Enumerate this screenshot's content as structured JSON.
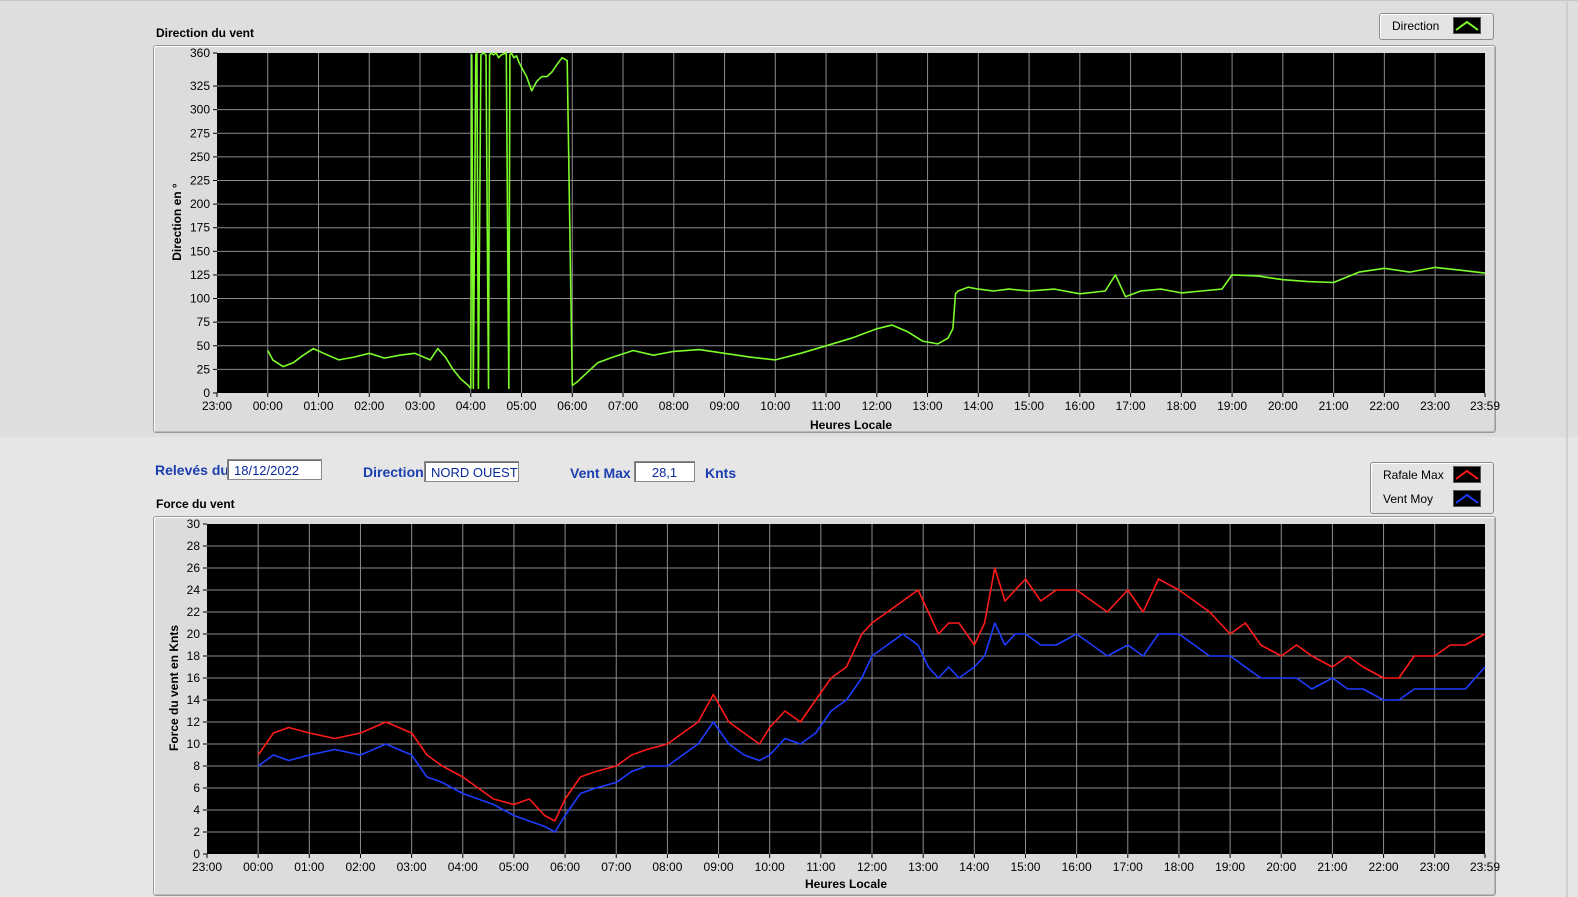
{
  "info": {
    "releves_label": "Relevés du",
    "releves_value": "18/12/2022",
    "direction_label": "Direction",
    "direction_value": "NORD OUEST",
    "ventmax_label": "Vent Max",
    "ventmax_value": "28,1",
    "ventmax_unit": "Knts"
  },
  "colors": {
    "direction": "#7cfc2a",
    "rafale": "#ff1a1a",
    "vent_moy": "#1e3cff",
    "plot_bg": "#000000",
    "grid": "#8c8c8c",
    "label_blue": "#1b3fb0"
  },
  "chart_data": [
    {
      "type": "line",
      "title": "Direction du vent",
      "xlabel": "Heures Locale",
      "ylabel": "Direction en °",
      "ylim": [
        0,
        360
      ],
      "xlim_hours": [
        -1,
        23.983
      ],
      "x_ticks": [
        "23:00",
        "00:00",
        "01:00",
        "02:00",
        "03:00",
        "04:00",
        "05:00",
        "06:00",
        "07:00",
        "08:00",
        "09:00",
        "10:00",
        "11:00",
        "12:00",
        "13:00",
        "14:00",
        "15:00",
        "16:00",
        "17:00",
        "18:00",
        "19:00",
        "20:00",
        "21:00",
        "22:00",
        "23:00",
        "23:59"
      ],
      "y_ticks": [
        0,
        25,
        50,
        75,
        100,
        125,
        150,
        175,
        200,
        225,
        250,
        275,
        300,
        325,
        360
      ],
      "grid": true,
      "legend_position": "top-right",
      "series": [
        {
          "name": "Direction",
          "color": "#7cfc2a",
          "x_hours": [
            0,
            0.1,
            0.3,
            0.5,
            0.7,
            0.9,
            1.1,
            1.4,
            1.7,
            2.0,
            2.3,
            2.6,
            2.9,
            3.2,
            3.35,
            3.5,
            3.65,
            3.8,
            3.95,
            4.0,
            4.02,
            4.05,
            4.1,
            4.12,
            4.15,
            4.2,
            4.25,
            4.3,
            4.35,
            4.37,
            4.4,
            4.45,
            4.5,
            4.55,
            4.6,
            4.7,
            4.75,
            4.77,
            4.8,
            4.85,
            4.9,
            4.95,
            5.0,
            5.1,
            5.2,
            5.3,
            5.4,
            5.5,
            5.6,
            5.7,
            5.8,
            5.9,
            6.0,
            6.05,
            6.1,
            6.3,
            6.5,
            6.8,
            7.2,
            7.6,
            8.0,
            8.5,
            9.0,
            9.5,
            10.0,
            10.5,
            11.0,
            11.5,
            12.0,
            12.3,
            12.6,
            12.9,
            13.2,
            13.4,
            13.5,
            13.55,
            13.6,
            13.8,
            14.0,
            14.3,
            14.6,
            15.0,
            15.5,
            16.0,
            16.5,
            16.7,
            16.9,
            17.2,
            17.6,
            18.0,
            18.4,
            18.8,
            19.0,
            19.5,
            20.0,
            20.5,
            21.0,
            21.5,
            22.0,
            22.5,
            23.0,
            23.5,
            23.983
          ],
          "y": [
            45,
            35,
            28,
            32,
            40,
            47,
            42,
            35,
            38,
            42,
            37,
            40,
            42,
            35,
            47,
            38,
            25,
            15,
            8,
            5,
            358,
            5,
            358,
            360,
            5,
            358,
            360,
            358,
            5,
            358,
            360,
            358,
            360,
            355,
            358,
            360,
            5,
            358,
            360,
            355,
            357,
            350,
            345,
            335,
            320,
            330,
            335,
            335,
            340,
            348,
            355,
            352,
            8,
            10,
            12,
            22,
            32,
            38,
            45,
            40,
            44,
            46,
            42,
            38,
            35,
            42,
            50,
            58,
            68,
            72,
            65,
            55,
            52,
            58,
            68,
            105,
            108,
            112,
            110,
            108,
            110,
            108,
            110,
            105,
            108,
            125,
            102,
            108,
            110,
            106,
            108,
            110,
            125,
            124,
            120,
            118,
            117,
            128,
            132,
            128,
            133,
            130,
            127
          ]
        }
      ]
    },
    {
      "type": "line",
      "title": "Force du vent",
      "xlabel": "Heures Locale",
      "ylabel": "Force du vent en Knts",
      "ylim": [
        0,
        30
      ],
      "xlim_hours": [
        -1,
        23.983
      ],
      "x_ticks": [
        "23:00",
        "00:00",
        "01:00",
        "02:00",
        "03:00",
        "04:00",
        "05:00",
        "06:00",
        "07:00",
        "08:00",
        "09:00",
        "10:00",
        "11:00",
        "12:00",
        "13:00",
        "14:00",
        "15:00",
        "16:00",
        "17:00",
        "18:00",
        "19:00",
        "20:00",
        "21:00",
        "22:00",
        "23:00",
        "23:59"
      ],
      "y_ticks": [
        0,
        2,
        4,
        6,
        8,
        10,
        12,
        14,
        16,
        18,
        20,
        22,
        24,
        26,
        28,
        30
      ],
      "grid": true,
      "legend_position": "top-right",
      "series": [
        {
          "name": "Rafale Max",
          "color": "#ff1a1a",
          "x_hours": [
            0,
            0.3,
            0.6,
            1.0,
            1.5,
            2.0,
            2.5,
            3.0,
            3.3,
            3.6,
            4.0,
            4.3,
            4.6,
            5.0,
            5.3,
            5.6,
            5.8,
            6.0,
            6.3,
            6.6,
            7.0,
            7.3,
            7.6,
            8.0,
            8.3,
            8.6,
            8.9,
            9.2,
            9.5,
            9.8,
            10.0,
            10.3,
            10.6,
            10.9,
            11.2,
            11.5,
            11.8,
            12.0,
            12.3,
            12.6,
            12.9,
            13.1,
            13.3,
            13.5,
            13.7,
            14.0,
            14.2,
            14.4,
            14.6,
            14.8,
            15.0,
            15.3,
            15.6,
            16.0,
            16.3,
            16.6,
            17.0,
            17.3,
            17.6,
            18.0,
            18.3,
            18.6,
            19.0,
            19.3,
            19.6,
            20.0,
            20.3,
            20.6,
            21.0,
            21.3,
            21.6,
            22.0,
            22.3,
            22.6,
            23.0,
            23.3,
            23.6,
            23.983
          ],
          "y": [
            9,
            11,
            11.5,
            11,
            10.5,
            11,
            12,
            11,
            9,
            8,
            7,
            6,
            5,
            4.5,
            5,
            3.5,
            3,
            5,
            7,
            7.5,
            8,
            9,
            9.5,
            10,
            11,
            12,
            14.5,
            12,
            11,
            10,
            11.5,
            13,
            12,
            14,
            16,
            17,
            20,
            21,
            22,
            23,
            24,
            22,
            20,
            21,
            21,
            19,
            21,
            26,
            23,
            24,
            25,
            23,
            24,
            24,
            23,
            22,
            24,
            22,
            25,
            24,
            23,
            22,
            20,
            21,
            19,
            18,
            19,
            18,
            17,
            18,
            17,
            16,
            16,
            18,
            18,
            19,
            19,
            20
          ]
        },
        {
          "name": "Vent Moy",
          "color": "#1e3cff",
          "x_hours": [
            0,
            0.3,
            0.6,
            1.0,
            1.5,
            2.0,
            2.5,
            3.0,
            3.3,
            3.6,
            4.0,
            4.3,
            4.6,
            5.0,
            5.3,
            5.6,
            5.8,
            6.0,
            6.3,
            6.6,
            7.0,
            7.3,
            7.6,
            8.0,
            8.3,
            8.6,
            8.9,
            9.2,
            9.5,
            9.8,
            10.0,
            10.3,
            10.6,
            10.9,
            11.2,
            11.5,
            11.8,
            12.0,
            12.3,
            12.6,
            12.9,
            13.1,
            13.3,
            13.5,
            13.7,
            14.0,
            14.2,
            14.4,
            14.6,
            14.8,
            15.0,
            15.3,
            15.6,
            16.0,
            16.3,
            16.6,
            17.0,
            17.3,
            17.6,
            18.0,
            18.3,
            18.6,
            19.0,
            19.3,
            19.6,
            20.0,
            20.3,
            20.6,
            21.0,
            21.3,
            21.6,
            22.0,
            22.3,
            22.6,
            23.0,
            23.3,
            23.6,
            23.983
          ],
          "y": [
            8,
            9,
            8.5,
            9,
            9.5,
            9,
            10,
            9,
            7,
            6.5,
            5.5,
            5,
            4.5,
            3.5,
            3,
            2.5,
            2,
            3.5,
            5.5,
            6,
            6.5,
            7.5,
            8,
            8,
            9,
            10,
            12,
            10,
            9,
            8.5,
            9,
            10.5,
            10,
            11,
            13,
            14,
            16,
            18,
            19,
            20,
            19,
            17,
            16,
            17,
            16,
            17,
            18,
            21,
            19,
            20,
            20,
            19,
            19,
            20,
            19,
            18,
            19,
            18,
            20,
            20,
            19,
            18,
            18,
            17,
            16,
            16,
            16,
            15,
            16,
            15,
            15,
            14,
            14,
            15,
            15,
            15,
            15,
            17
          ]
        }
      ]
    }
  ]
}
